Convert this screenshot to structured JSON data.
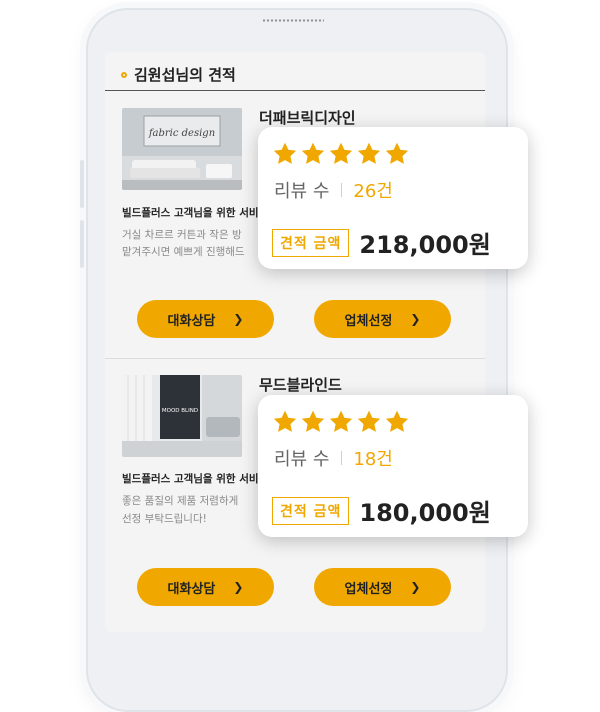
{
  "screen": {
    "title": "김원섭님의 견적"
  },
  "quotes": [
    {
      "company": "더패브릭디자인",
      "thumb_text": "fabric design",
      "headline": "빌드플러스 고객님을 위한 서비스",
      "desc_lines": [
        "거실 차르르 커튼과 작은 방",
        "맡겨주시면 예쁘게 진행해드"
      ],
      "buttons": {
        "chat": "대화상담",
        "select": "업체선정"
      },
      "rating": {
        "stars": 5,
        "review_label": "리뷰 수",
        "review_count": "26건"
      },
      "price_label": "견적 금액",
      "price": "218,000원"
    },
    {
      "company": "무드블라인드",
      "thumb_text": "MOOD BLIND",
      "headline": "빌드플러스 고객님을 위한 서비스",
      "desc_lines": [
        "좋은 품질의 제품 저렴하게",
        "선정 부탁드립니다!"
      ],
      "buttons": {
        "chat": "대화상담",
        "select": "업체선정"
      },
      "rating": {
        "stars": 5,
        "review_label": "리뷰 수",
        "review_count": "18건"
      },
      "price_label": "견적 금액",
      "price": "180,000원"
    }
  ],
  "colors": {
    "accent": "#f0a800",
    "text": "#222222",
    "muted": "#8a8a8a"
  },
  "icons": {
    "star": "star-icon",
    "chevron": "chevron-right-icon",
    "title_marker": "circle-marker-icon"
  }
}
